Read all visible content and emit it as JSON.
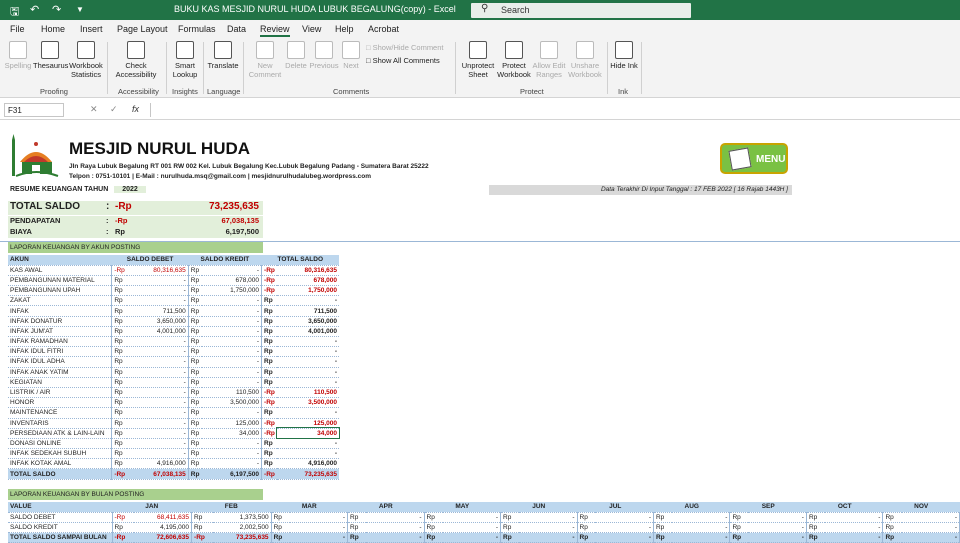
{
  "titlebar": {
    "doc_title": "BUKU KAS MESJID NURUL HUDA LUBUK BEGALUNG(copy)  -  Excel",
    "search_placeholder": "Search"
  },
  "menu_tabs": [
    "File",
    "Home",
    "Insert",
    "Page Layout",
    "Formulas",
    "Data",
    "Review",
    "View",
    "Help",
    "Acrobat"
  ],
  "active_tab": "Review",
  "ribbon": {
    "proofing": {
      "label": "Proofing",
      "spelling": "Spelling",
      "thesaurus": "Thesaurus",
      "workbook_statistics": "Workbook Statistics"
    },
    "accessibility": {
      "label": "Accessibility",
      "check": "Check Accessibility"
    },
    "insights": {
      "label": "Insights",
      "smart_lookup": "Smart Lookup"
    },
    "language": {
      "label": "Language",
      "translate": "Translate"
    },
    "comments": {
      "label": "Comments",
      "new": "New Comment",
      "delete": "Delete",
      "previous": "Previous",
      "next": "Next",
      "show_hide": "Show/Hide Comment",
      "show_all": "Show All Comments"
    },
    "protect": {
      "label": "Protect",
      "unprotect_sheet": "Unprotect Sheet",
      "protect_workbook": "Protect Workbook",
      "allow_edit": "Allow Edit Ranges",
      "unshare": "Unshare Workbook"
    },
    "ink": {
      "label": "Ink",
      "hide_ink": "Hide Ink"
    }
  },
  "formula_bar": {
    "name_box": "F31",
    "fx": "fx",
    "value": ""
  },
  "sheet": {
    "org_name": "MESJID NURUL HUDA",
    "address": "Jln Raya Lubuk Begalung RT 001 RW 002 Kel. Lubuk Begalung Kec.Lubuk Begalung Padang - Sumatera Barat 25222",
    "contact": "Telpon : 0751-10101 | E-Mail : nurulhuda.msq@gmail.com | mesjidnurulhudalubeg.wordpress.com",
    "menu_label": "MENU",
    "resume_label": "RESUME KEUANGAN TAHUN",
    "resume_year": "2022",
    "last_input": "Data Terakhir Di Input Tanggal : 17 FEB 2022 [  16 Rajab 1443H ]",
    "summary": [
      {
        "label": "TOTAL SALDO",
        "sep": ":",
        "cur": "-Rp",
        "value": "73,235,635",
        "red": true
      },
      {
        "label": "PENDAPATAN",
        "sep": ":",
        "cur": "-Rp",
        "value": "67,038,135",
        "red": true
      },
      {
        "label": "BIAYA",
        "sep": ":",
        "cur": "Rp",
        "value": "6,197,500",
        "red": false
      }
    ],
    "section_account": "LAPORAN KEUANGAN BY AKUN POSTING",
    "account_headers": [
      "AKUN",
      "SALDO DEBET",
      "SALDO KREDIT",
      "TOTAL SALDO"
    ],
    "accounts": [
      [
        "KAS AWAL",
        "-Rp",
        "80,316,635",
        "Rp",
        "-",
        "-Rp",
        "80,316,635"
      ],
      [
        "PEMBANGUNAN MATERIAL",
        "Rp",
        "-",
        "Rp",
        "678,000",
        "-Rp",
        "678,000"
      ],
      [
        "PEMBANGUNAN UPAH",
        "Rp",
        "-",
        "Rp",
        "1,750,000",
        "-Rp",
        "1,750,000"
      ],
      [
        "ZAKAT",
        "Rp",
        "-",
        "Rp",
        "-",
        "Rp",
        "-"
      ],
      [
        "INFAK",
        "Rp",
        "711,500",
        "Rp",
        "-",
        "Rp",
        "711,500"
      ],
      [
        "INFAK DONATUR",
        "Rp",
        "3,650,000",
        "Rp",
        "-",
        "Rp",
        "3,650,000"
      ],
      [
        "INFAK JUM'AT",
        "Rp",
        "4,001,000",
        "Rp",
        "-",
        "Rp",
        "4,001,000"
      ],
      [
        "INFAK RAMADHAN",
        "Rp",
        "-",
        "Rp",
        "-",
        "Rp",
        "-"
      ],
      [
        "INFAK IDUL FITRI",
        "Rp",
        "-",
        "Rp",
        "-",
        "Rp",
        "-"
      ],
      [
        "INFAK IDUL ADHA",
        "Rp",
        "-",
        "Rp",
        "-",
        "Rp",
        "-"
      ],
      [
        "INFAK ANAK YATIM",
        "Rp",
        "-",
        "Rp",
        "-",
        "Rp",
        "-"
      ],
      [
        "KEGIATAN",
        "Rp",
        "-",
        "Rp",
        "-",
        "Rp",
        "-"
      ],
      [
        "LISTRIK / AIR",
        "Rp",
        "-",
        "Rp",
        "110,500",
        "-Rp",
        "110,500"
      ],
      [
        "HONOR",
        "Rp",
        "-",
        "Rp",
        "3,500,000",
        "-Rp",
        "3,500,000"
      ],
      [
        "MAINTENANCE",
        "Rp",
        "-",
        "Rp",
        "-",
        "Rp",
        "-"
      ],
      [
        "INVENTARIS",
        "Rp",
        "-",
        "Rp",
        "125,000",
        "-Rp",
        "125,000"
      ],
      [
        "PERSEDIAAN ATK & LAIN-LAIN",
        "Rp",
        "-",
        "Rp",
        "34,000",
        "-Rp",
        "34,000"
      ],
      [
        "DONASI ONLINE",
        "Rp",
        "-",
        "Rp",
        "-",
        "Rp",
        "-"
      ],
      [
        "INFAK SEDEKAH SUBUH",
        "Rp",
        "-",
        "Rp",
        "-",
        "Rp",
        "-"
      ],
      [
        "INFAK KOTAK AMAL",
        "Rp",
        "4,916,000",
        "Rp",
        "-",
        "Rp",
        "4,916,000"
      ]
    ],
    "account_total": [
      "TOTAL SALDO",
      "-Rp",
      "67,038,135",
      "Rp",
      "6,197,500",
      "-Rp",
      "73,235,635"
    ],
    "section_month": "LAPORAN KEUANGAN BY BULAN POSTING",
    "month_headers": [
      "VALUE",
      "JAN",
      "FEB",
      "MAR",
      "APR",
      "MAY",
      "JUN",
      "JUL",
      "AUG",
      "SEP",
      "OCT",
      "NOV"
    ],
    "month_rows": [
      {
        "label": "SALDO DEBET",
        "jan": [
          "-Rp",
          "68,411,635"
        ],
        "feb": [
          "Rp",
          "1,373,500"
        ]
      },
      {
        "label": "SALDO KREDIT",
        "jan": [
          "Rp",
          "4,195,000"
        ],
        "feb": [
          "Rp",
          "2,002,500"
        ]
      },
      {
        "label": "TOTAL SALDO SAMPAI BULAN",
        "jan": [
          "-Rp",
          "72,606,635"
        ],
        "feb": [
          "-Rp",
          "73,235,635"
        ]
      }
    ],
    "empty_cell": [
      "Rp",
      "-"
    ]
  }
}
